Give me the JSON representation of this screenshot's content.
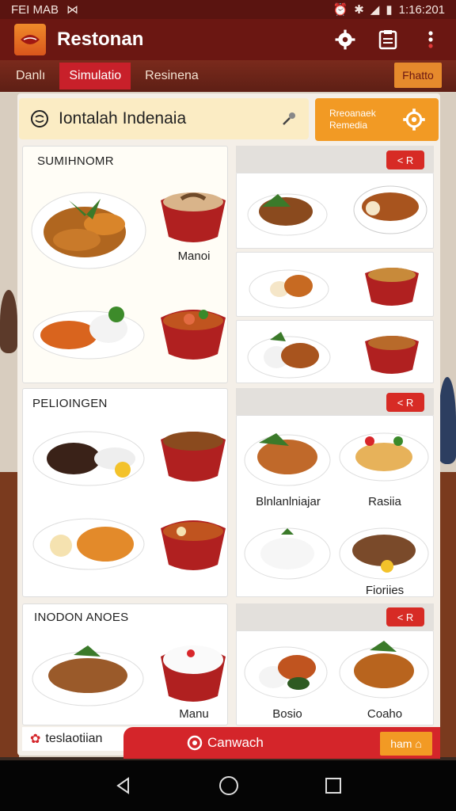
{
  "status_bar": {
    "left_text": "FEI MAB",
    "time": "1:16:201"
  },
  "app": {
    "title": "Restonan"
  },
  "tabs": [
    {
      "label": "Danlı",
      "active": false
    },
    {
      "label": "Simulatio",
      "active": true
    },
    {
      "label": "Resinena",
      "active": false
    }
  ],
  "photo_button": "Fhatto",
  "search": {
    "text": "Iontalah Indenaia"
  },
  "filter_button": {
    "line1": "Rreoanaek",
    "line2": "Remedia"
  },
  "sections": [
    {
      "title": "SUMIHNOMR",
      "labels": [
        "Manoi"
      ],
      "badge": "< R"
    },
    {
      "title": "PELIOINGEN",
      "labels": [
        "Blnlanlniajar",
        "Rasiia",
        "Fioriies"
      ],
      "badge": "< R"
    },
    {
      "title": "INODON ANOES",
      "labels": [
        "Manu",
        "Bosio",
        "Coaho"
      ],
      "badge": "< R"
    }
  ],
  "bottom": {
    "left_label": "teslaotiian",
    "checkout_label": "Canwach",
    "cart_button": "ham ⌂"
  },
  "colors": {
    "primary": "#6b1712",
    "accent": "#d4252a",
    "orange": "#f29a24",
    "search_bg": "#fbecc4"
  }
}
